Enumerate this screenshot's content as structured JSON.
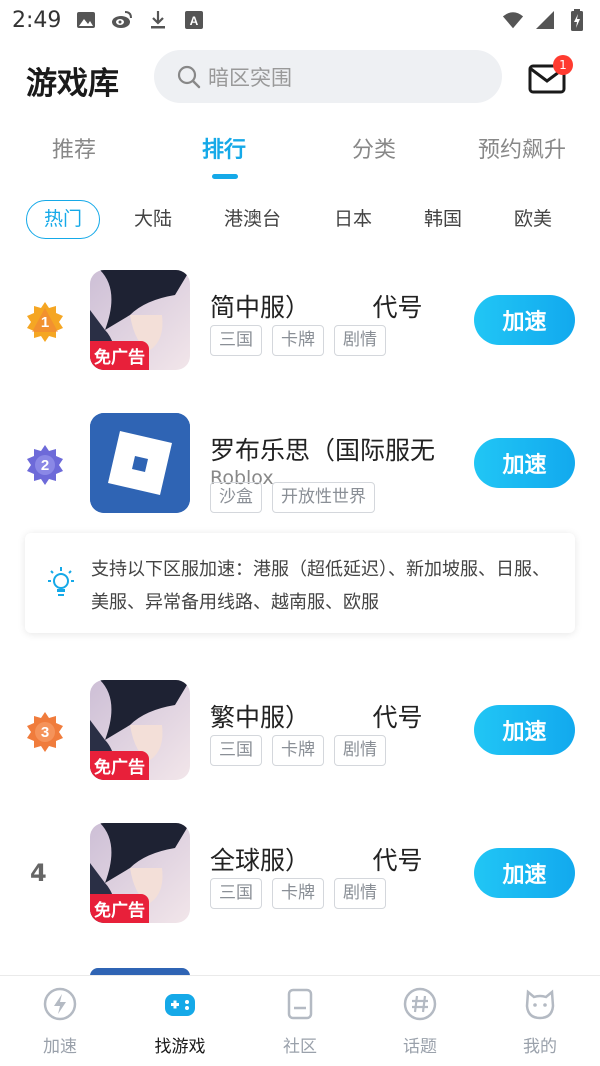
{
  "status_bar": {
    "time": "2:49",
    "left_icons": [
      "image-icon",
      "weibo-icon",
      "download-icon",
      "a-icon"
    ],
    "right_icons": [
      "wifi-icon",
      "signal-icon",
      "battery-icon"
    ]
  },
  "header": {
    "title": "游戏库",
    "search_placeholder": "暗区突围",
    "mail_badge": "1"
  },
  "tabs": [
    {
      "label": "推荐",
      "active": false
    },
    {
      "label": "排行",
      "active": true
    },
    {
      "label": "分类",
      "active": false
    },
    {
      "label": "预约飙升",
      "active": false
    }
  ],
  "regions": [
    {
      "label": "热门",
      "active": true
    },
    {
      "label": "大陆",
      "active": false
    },
    {
      "label": "港澳台",
      "active": false
    },
    {
      "label": "日本",
      "active": false
    },
    {
      "label": "韩国",
      "active": false
    },
    {
      "label": "欧美",
      "active": false
    }
  ],
  "games": [
    {
      "rank": "1",
      "name": "简中服）　　　代号",
      "tags": [
        "三国",
        "卡牌",
        "剧情"
      ],
      "badge": "免广告",
      "button": "加速"
    },
    {
      "rank": "2",
      "name": "罗布乐思（国际服无",
      "subtitle": "Roblox",
      "tags": [
        "沙盒",
        "开放性世界"
      ],
      "button": "加速"
    },
    {
      "rank": "3",
      "name": "繁中服）　　　代号",
      "tags": [
        "三国",
        "卡牌",
        "剧情"
      ],
      "badge": "免广告",
      "button": "加速"
    },
    {
      "rank": "4",
      "name": "全球服）　　　代号",
      "tags": [
        "三国",
        "卡牌",
        "剧情"
      ],
      "badge": "免广告",
      "button": "加速"
    }
  ],
  "notice": {
    "text": "支持以下区服加速：港服（超低延迟）、新加坡服、日服、美服、异常备用线路、越南服、欧服"
  },
  "bottom_nav": [
    {
      "label": "加速",
      "icon": "lightning-icon",
      "active": false
    },
    {
      "label": "找游戏",
      "icon": "gamepad-icon",
      "active": true
    },
    {
      "label": "社区",
      "icon": "document-icon",
      "active": false
    },
    {
      "label": "话题",
      "icon": "hashtag-icon",
      "active": false
    },
    {
      "label": "我的",
      "icon": "cat-face-icon",
      "active": false
    }
  ],
  "colors": {
    "accent": "#15a9e8",
    "badge_red": "#e8203a",
    "roblox_blue": "#2f64b4",
    "rank1": "#f5a623",
    "rank2": "#6d6ad9",
    "rank3": "#f07c3c"
  }
}
